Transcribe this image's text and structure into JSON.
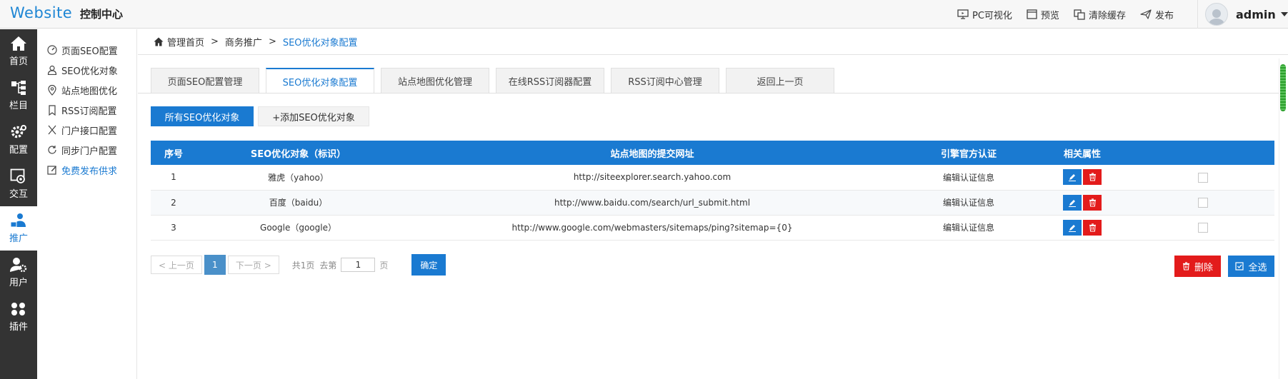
{
  "header": {
    "logo": "Website",
    "title": "控制中心",
    "actions": [
      {
        "label": "PC可视化",
        "icon": "monitor-icon"
      },
      {
        "label": "预览",
        "icon": "preview-window-icon"
      },
      {
        "label": "清除缓存",
        "icon": "clear-cache-icon"
      },
      {
        "label": "发布",
        "icon": "paper-plane-icon"
      }
    ],
    "user": "admin"
  },
  "side_nav": [
    {
      "label": "首页",
      "icon": "home-icon"
    },
    {
      "label": "栏目",
      "icon": "sitemap-icon"
    },
    {
      "label": "配置",
      "icon": "gears-icon"
    },
    {
      "label": "交互",
      "icon": "interaction-icon"
    },
    {
      "label": "推广",
      "icon": "promotion-icon",
      "active": true
    },
    {
      "label": "用户",
      "icon": "user-gear-icon"
    },
    {
      "label": "插件",
      "icon": "plugin-icon"
    }
  ],
  "sub_nav": [
    {
      "label": "页面SEO配置",
      "icon": "gauge-icon"
    },
    {
      "label": "SEO优化对象",
      "icon": "user-outline-icon"
    },
    {
      "label": "站点地图优化",
      "icon": "map-pin-icon"
    },
    {
      "label": "RSS订阅配置",
      "icon": "bookmark-icon"
    },
    {
      "label": "门户接口配置",
      "icon": "scissors-icon"
    },
    {
      "label": "同步门户配置",
      "icon": "sync-icon"
    },
    {
      "label": "免费发布供求",
      "icon": "edit-square-icon"
    }
  ],
  "breadcrumb": {
    "home": "管理首页",
    "sep": ">",
    "middle": "商务推广",
    "current": "SEO优化对象配置"
  },
  "tabs": [
    {
      "label": "页面SEO配置管理"
    },
    {
      "label": "SEO优化对象配置",
      "active": true
    },
    {
      "label": "站点地图优化管理"
    },
    {
      "label": "在线RSS订阅器配置"
    },
    {
      "label": "RSS订阅中心管理"
    },
    {
      "label": "返回上一页"
    }
  ],
  "subtabs": {
    "all": "所有SEO优化对象",
    "add": "+添加SEO优化对象"
  },
  "table": {
    "headers": [
      "序号",
      "SEO优化对象（标识）",
      "站点地图的提交网址",
      "引擎官方认证",
      "相关属性"
    ],
    "rows": [
      {
        "no": "1",
        "name": "雅虎（yahoo）",
        "url": "http://siteexplorer.search.yahoo.com",
        "auth": "编辑认证信息"
      },
      {
        "no": "2",
        "name": "百度（baidu）",
        "url": "http://www.baidu.com/search/url_submit.html",
        "auth": "编辑认证信息"
      },
      {
        "no": "3",
        "name": "Google（google）",
        "url": "http://www.google.com/webmasters/sitemaps/ping?sitemap={0}",
        "auth": "编辑认证信息"
      }
    ]
  },
  "pager": {
    "prev": "< 上一页",
    "current": "1",
    "next": "下一页 >",
    "total": "共1页",
    "goto_prefix": "去第",
    "goto_value": "1",
    "goto_suffix": "页",
    "confirm": "确定"
  },
  "actions": {
    "delete": "删除",
    "select_all": "全选"
  },
  "colors": {
    "accent": "#1a7ad1",
    "danger": "#e31b1b",
    "sidebar": "#333333"
  }
}
